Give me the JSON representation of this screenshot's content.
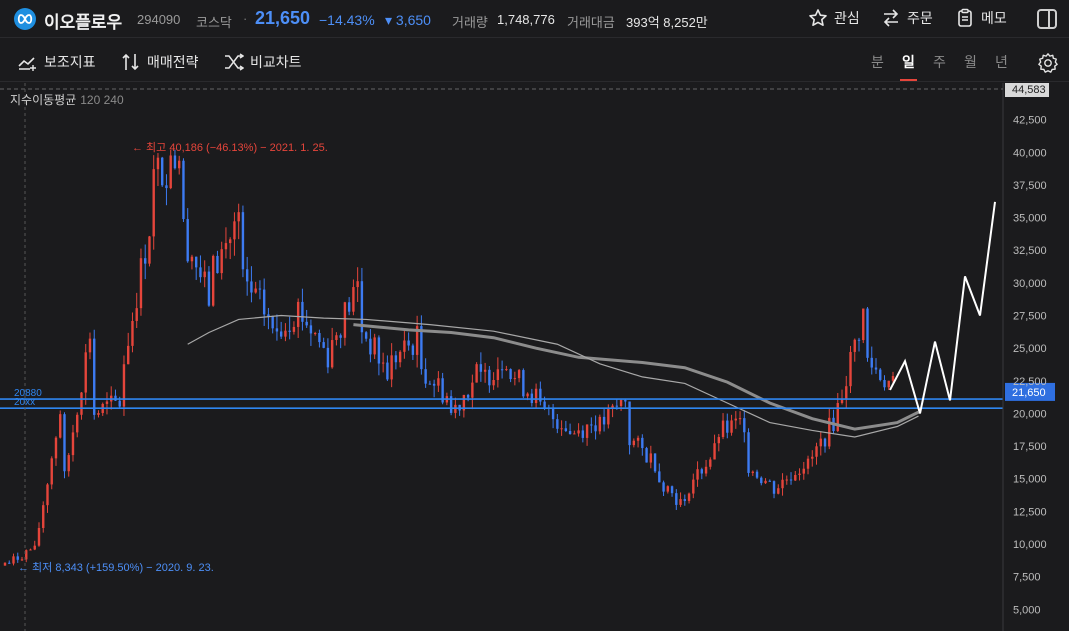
{
  "header": {
    "logo_icon": "infinity-logo-icon",
    "stock_name": "이오플로우",
    "code": "294090",
    "market": "코스닥",
    "separator": "·",
    "price": "21,650",
    "change_pct": "−14.43%",
    "change_amount": "▾ 3,650",
    "volume_label": "거래량",
    "volume_value": "1,748,776",
    "amount_label": "거래대금",
    "amount_value": "393억 8,252만",
    "buttons": [
      {
        "label": "관심",
        "icon": "star-icon"
      },
      {
        "label": "주문",
        "icon": "swap-arrows-icon"
      },
      {
        "label": "메모",
        "icon": "clipboard-icon"
      }
    ],
    "side_panel_icon": "side-panel-icon"
  },
  "toolbar": {
    "items": [
      {
        "label": "보조지표",
        "icon": "indicator-icon"
      },
      {
        "label": "매매전략",
        "icon": "strategy-icon"
      },
      {
        "label": "비교차트",
        "icon": "compare-icon"
      }
    ],
    "periods": [
      "분",
      "일",
      "주",
      "월",
      "년"
    ],
    "active_period": "일",
    "settings_icon": "gear-icon"
  },
  "chart_data": {
    "type": "candlestick",
    "indicator_legend": {
      "label": "지수이동평균",
      "params": "120 240"
    },
    "y_ticks": [
      "42,500",
      "40,000",
      "37,500",
      "35,000",
      "32,500",
      "30,000",
      "27,500",
      "25,000",
      "22,500",
      "20,000",
      "17,500",
      "15,000",
      "12,500",
      "10,000",
      "7,500",
      "5,000"
    ],
    "y_tick_values": [
      42500,
      40000,
      37500,
      35000,
      32500,
      30000,
      27500,
      25000,
      22500,
      20000,
      17500,
      15000,
      12500,
      10000,
      7500,
      5000
    ],
    "ylim": [
      3800,
      45000
    ],
    "top_marker": "44,583",
    "current_price_label": "21,650",
    "current_price": 21650,
    "high_annotation": "← 최고 40,186 (−46.13%) − 2021. 1. 25.",
    "high_value": 40186,
    "low_annotation": "← 최저 8,343 (+159.50%) − 2020. 9. 23.",
    "low_value": 8343,
    "horizontal_lines": [
      {
        "label": "20880",
        "value": 21100
      },
      {
        "label": "20xx",
        "value": 20400
      }
    ],
    "price_path": [
      [
        8343,
        9800
      ],
      [
        9500,
        22000
      ],
      [
        15000,
        28000
      ],
      [
        20000,
        21000
      ],
      [
        24000,
        36000
      ],
      [
        38000,
        40186
      ],
      [
        34000,
        28000
      ],
      [
        31000,
        35500
      ],
      [
        30000,
        27000
      ],
      [
        26000,
        28500
      ],
      [
        27500,
        24000
      ],
      [
        25500,
        30500
      ],
      [
        26500,
        22500
      ],
      [
        24000,
        26000
      ],
      [
        23500,
        21000
      ],
      [
        20000,
        23500
      ],
      [
        22500,
        24800
      ],
      [
        23000,
        21000
      ],
      [
        20200,
        19000
      ],
      [
        18500,
        19500
      ],
      [
        19000,
        21500
      ],
      [
        18000,
        16000
      ],
      [
        15000,
        12500
      ],
      [
        14500,
        17500
      ],
      [
        18500,
        19500
      ],
      [
        16000,
        14000
      ],
      [
        14500,
        16500
      ],
      [
        16000,
        20000
      ],
      [
        20500,
        28800
      ],
      [
        24000,
        21650
      ]
    ],
    "ema120": [
      [
        43,
        25300
      ],
      [
        48,
        26200
      ],
      [
        55,
        27200
      ],
      [
        65,
        27500
      ],
      [
        75,
        27300
      ],
      [
        85,
        27200
      ],
      [
        100,
        26800
      ],
      [
        115,
        26300
      ],
      [
        130,
        25300
      ],
      [
        140,
        23800
      ],
      [
        150,
        22800
      ],
      [
        160,
        22300
      ],
      [
        170,
        20800
      ],
      [
        180,
        19300
      ],
      [
        190,
        18700
      ],
      [
        200,
        18200
      ],
      [
        210,
        19000
      ],
      [
        215,
        19800
      ]
    ],
    "ema240": [
      [
        82,
        26800
      ],
      [
        95,
        26400
      ],
      [
        105,
        26200
      ],
      [
        115,
        25800
      ],
      [
        125,
        25000
      ],
      [
        135,
        24300
      ],
      [
        150,
        23900
      ],
      [
        160,
        23500
      ],
      [
        170,
        22400
      ],
      [
        180,
        20800
      ],
      [
        190,
        19600
      ],
      [
        200,
        18800
      ],
      [
        210,
        19300
      ],
      [
        215,
        20100
      ]
    ],
    "forecast_line": [
      [
        21800,
        0
      ],
      [
        24000,
        1
      ],
      [
        20000,
        2
      ],
      [
        25500,
        3
      ],
      [
        21000,
        4
      ],
      [
        30500,
        5
      ],
      [
        27500,
        6
      ],
      [
        36200,
        7
      ]
    ]
  }
}
